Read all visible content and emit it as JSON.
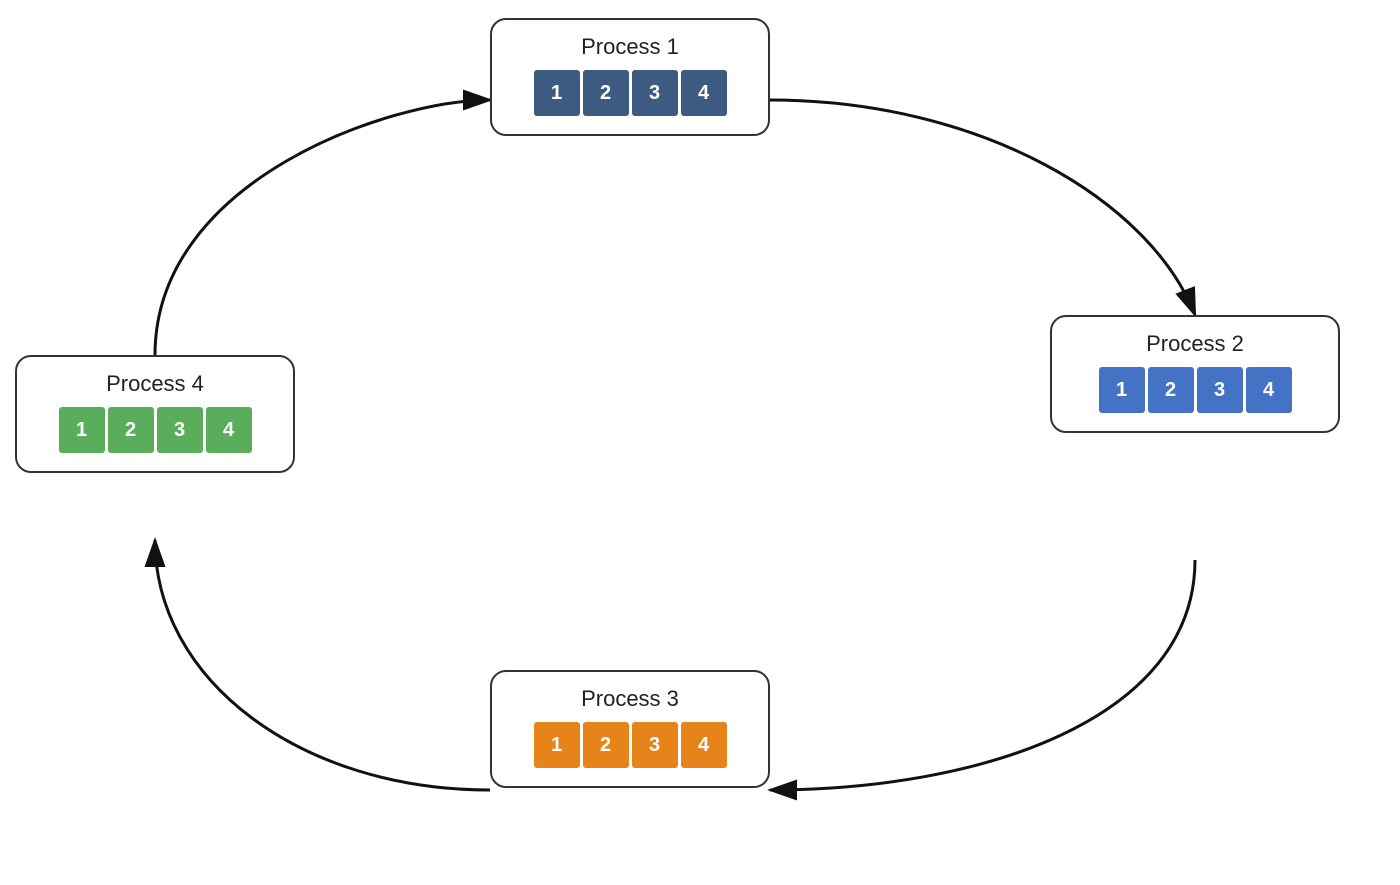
{
  "processes": [
    {
      "id": "process1",
      "title": "Process 1",
      "blocks": [
        "1",
        "2",
        "3",
        "4"
      ],
      "color": "#3d5a80"
    },
    {
      "id": "process2",
      "title": "Process 2",
      "blocks": [
        "1",
        "2",
        "3",
        "4"
      ],
      "color": "#4472c4"
    },
    {
      "id": "process3",
      "title": "Process 3",
      "blocks": [
        "1",
        "2",
        "3",
        "4"
      ],
      "color": "#e6841a"
    },
    {
      "id": "process4",
      "title": "Process 4",
      "blocks": [
        "1",
        "2",
        "3",
        "4"
      ],
      "color": "#5aad5a"
    }
  ],
  "arrows": {
    "color": "#111111",
    "strokeWidth": 3
  }
}
